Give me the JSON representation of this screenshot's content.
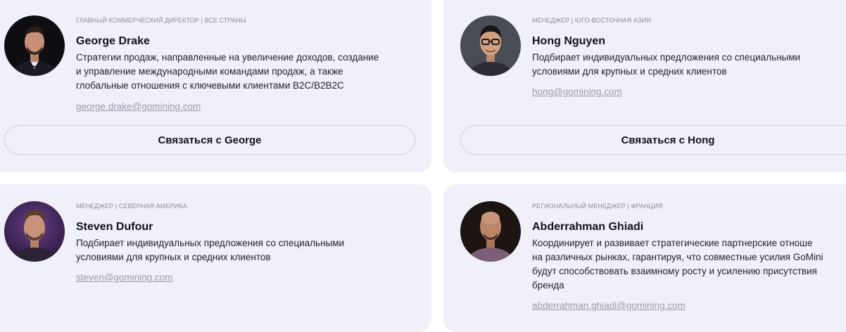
{
  "contacts": [
    {
      "role": "ГЛАВНЫЙ КОММЕРЧЕСКИЙ ДИРЕКТОР | ВСЕ СТРАНЫ",
      "name": "George Drake",
      "desc": [
        "Стратегии продаж, направленные на увеличение доходов, создание",
        "и управление международными командами продаж, а также",
        "глобальные отношения с ключевыми клиентами B2C/B2B2C"
      ],
      "email": "george.drake@gomining.com",
      "button": "Связаться с George"
    },
    {
      "role": "МЕНЕДЖЕР | ЮГО-ВОСТОЧНАЯ АЗИЯ",
      "name": "Hong Nguyen",
      "desc": [
        "Подбирает индивидуальных предложения со специальными",
        "условиями для крупных и средних клиентов"
      ],
      "email": "hong@gomining.com",
      "button": "Связаться с Hong"
    },
    {
      "role": "МЕНЕДЖЕР | СЕВЕРНАЯ АМЕРИКА",
      "name": "Steven Dufour",
      "desc": [
        "Подбирает индивидуальных предложения со специальными",
        "условиями для крупных и средних клиентов"
      ],
      "email": "steven@gomining.com"
    },
    {
      "role": "РЕГИОНАЛЬНЫЙ МЕНЕДЖЕР | ФРАНЦИЯ",
      "name": "Abderrahman Ghiadi",
      "desc": [
        "Координирует и развивает стратегические партнерские отноше",
        "на различных рынках, гарантируя, что совместные усилия GoMini",
        "будут способствовать взаимному росту и усилению присутствия",
        "бренда"
      ],
      "email": "abderrahman.ghiadi@gomining.com"
    }
  ],
  "colors": {
    "card_bg": "#f0f0f8",
    "email": "#9a9cab",
    "role": "#8a8ca0"
  }
}
